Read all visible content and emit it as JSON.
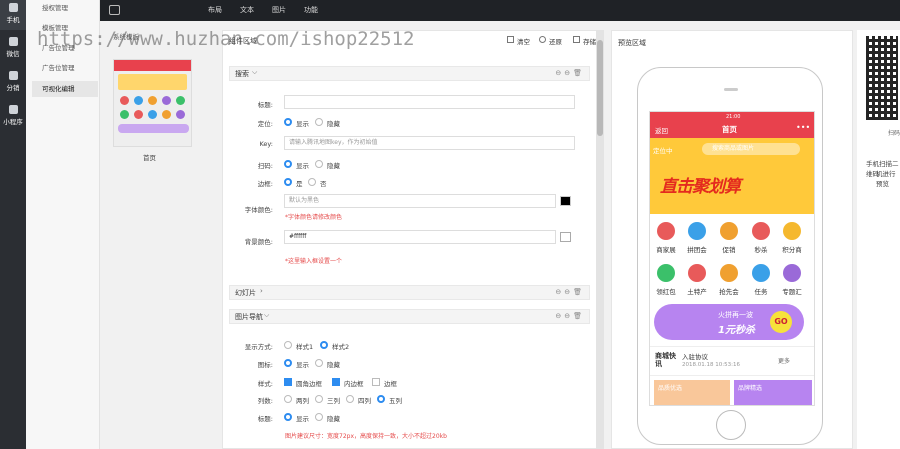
{
  "rail": {
    "items": [
      {
        "label": "手机",
        "icon": "phone-icon"
      },
      {
        "label": "微信",
        "icon": "wechat-icon"
      },
      {
        "label": "分销",
        "icon": "share-icon"
      },
      {
        "label": "小程序",
        "icon": "app-icon"
      }
    ]
  },
  "subnav": {
    "items": [
      "授权管理",
      "模板管理",
      "广告位管理",
      "广告位管理",
      "可视化编辑"
    ]
  },
  "topbar": {
    "links": [
      "布局",
      "文本",
      "图片",
      "功能"
    ]
  },
  "thumbs": {
    "header": "系统模板",
    "thumb_label": "首页"
  },
  "editor": {
    "title": "组件区域",
    "actions": [
      "清空",
      "还原",
      "存储"
    ],
    "sections": [
      {
        "title": "搜索"
      },
      {
        "title": "幻灯片"
      },
      {
        "title": "图片导航"
      }
    ],
    "search": {
      "title_label": "标题:",
      "pos_label": "定位:",
      "pos_options": [
        "显示",
        "隐藏"
      ],
      "key_label": "Key:",
      "key_placeholder": "请输入腾讯地图key，作为初始值",
      "scan_label": "扫码:",
      "scan_options": [
        "显示",
        "隐藏"
      ],
      "fill_label": "边框:",
      "fill_options": [
        "是",
        "否"
      ],
      "font_color_label": "字体颜色:",
      "font_color_placeholder": "默认为黑色",
      "font_color_hint": "*字体颜色请修改颜色",
      "bg_color_label": "背景颜色:",
      "bg_color_value": "#ffffff",
      "bg_color_hint": "*这里输入框设置一个"
    },
    "nav": {
      "style_label": "显示方式:",
      "style_options": [
        "样式1",
        "样式2"
      ],
      "icon_label": "图标:",
      "icon_options": [
        "显示",
        "隐藏"
      ],
      "shape_label": "样式:",
      "shape_options": [
        "圆角边框",
        "内边框",
        "边框"
      ],
      "cols_label": "列数:",
      "cols_options": [
        "两列",
        "三列",
        "四列",
        "五列"
      ],
      "title_label": "标题:",
      "title_options": [
        "显示",
        "隐藏"
      ],
      "hint": "图片建议尺寸：宽度72px，高度保持一致，大小不超过20kb"
    }
  },
  "preview": {
    "title": "预览区域",
    "phone": {
      "status": "21:00",
      "back": "返回",
      "page_title": "首页",
      "search_loc": "定位中",
      "search_placeholder": "搜索商品或图片",
      "banner_text": "直击聚划算",
      "icons_row1": [
        "商家展",
        "拼团会",
        "促销",
        "秒杀",
        "积分商"
      ],
      "icons_row2": [
        "领红包",
        "土特产",
        "抢先会",
        "任务",
        "专题汇"
      ],
      "promo_title": "火拼再一波",
      "promo_sub": "1元秒杀",
      "promo_go": "GO",
      "news_logo": "商城快讯",
      "news_title": "入驻协议",
      "news_time": "2018.01.18 10:53:16",
      "news_more": "更多",
      "goods": [
        "品质优选",
        "品牌精选"
      ]
    }
  },
  "qr": {
    "caption1": "扫码",
    "caption2": "手机扫描二维码",
    "caption3": "机进行预览"
  },
  "watermark": "https://www.huzhan.com/ishop22512",
  "colors": {
    "accent": "#2d8cf0",
    "brand_red": "#e8414d",
    "hint_red": "#e54b4b"
  }
}
